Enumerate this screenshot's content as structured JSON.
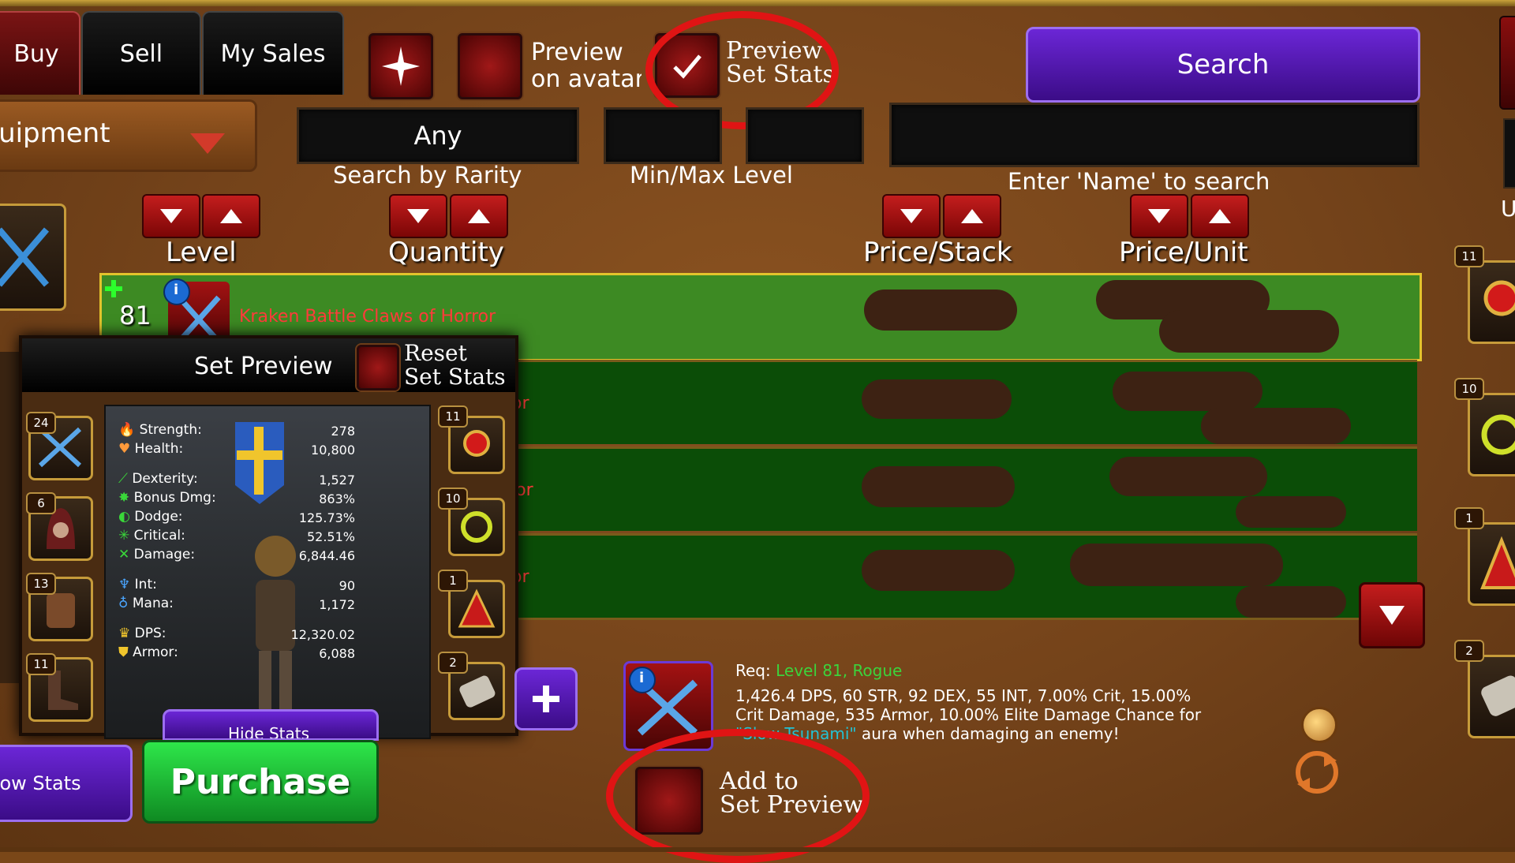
{
  "tabs": [
    {
      "label": "Buy",
      "active": true
    },
    {
      "label": "Sell",
      "active": false
    },
    {
      "label": "My Sales",
      "active": false
    }
  ],
  "toolbar": {
    "preview_avatar_label": "Preview\non avatar",
    "preview_set_stats_label": "Preview\nSet Stats",
    "preview_set_stats_checked": true,
    "search_label": "Search"
  },
  "filters": {
    "category_value": "Equipment",
    "rarity_value": "Any",
    "rarity_caption": "Search by Rarity",
    "level_caption": "Min/Max Level",
    "min_level": "",
    "max_level": "",
    "name_caption": "Enter 'Name' to search",
    "name_value": ""
  },
  "columns": {
    "level": "Level",
    "quantity": "Quantity",
    "price_stack": "Price/Stack",
    "price_unit": "Price/Unit"
  },
  "listings": [
    {
      "level": "81",
      "name": "Kraken Battle Claws of Horror",
      "selected": true
    },
    {
      "level": "",
      "name": "or",
      "selected": false
    },
    {
      "level": "",
      "name": "rror",
      "selected": false
    },
    {
      "level": "",
      "name": "or",
      "selected": false
    }
  ],
  "set_preview": {
    "title": "Set Preview",
    "reset_label": "Reset\nSet Stats",
    "stats": [
      {
        "label": "Strength:",
        "value": "278"
      },
      {
        "label": "Health:",
        "value": "10,800"
      },
      {
        "label": "Dexterity:",
        "value": "1,527"
      },
      {
        "label": "Bonus Dmg:",
        "value": "863%"
      },
      {
        "label": "Dodge:",
        "value": "125.73%"
      },
      {
        "label": "Critical:",
        "value": "52.51%"
      },
      {
        "label": "Damage:",
        "value": "6,844.46"
      },
      {
        "label": "Int:",
        "value": "90"
      },
      {
        "label": "Mana:",
        "value": "1,172"
      },
      {
        "label": "DPS:",
        "value": "12,320.02"
      },
      {
        "label": "Armor:",
        "value": "6,088"
      }
    ],
    "hide_stats_label": "Hide Stats",
    "left_slots": [
      "24",
      "6",
      "13",
      "11"
    ],
    "right_slots": [
      "11",
      "10",
      "1",
      "2"
    ]
  },
  "bottom": {
    "show_stats_label": "Show Stats",
    "purchase_label": "Purchase",
    "add_to_set_label": "Add to\nSet Preview",
    "req_prefix": "Req:",
    "req_level": "Level 81",
    "req_class": "Rogue",
    "description_1": "1,426.4 DPS, 60 STR, 92 DEX, 55 INT, 7.00% Crit, 15.00%",
    "description_2": "Crit Damage, 535 Armor, 10.00% Elite Damage Chance for",
    "description_3_link": "\"Slow Tsunami\"",
    "description_3_rest": " aura when damaging an enemy!"
  },
  "right_column": {
    "slots": [
      "11",
      "10",
      "1",
      "2"
    ],
    "edge_letter": "U"
  },
  "colors": {
    "background": "#7a4718",
    "selected_row": "#3d8a23",
    "plain_row": "#0b4d07",
    "item_name": "#ff3b3b",
    "req_green": "#3cd33c",
    "link_teal": "#21c3d6",
    "annotation_red": "#e01414"
  }
}
